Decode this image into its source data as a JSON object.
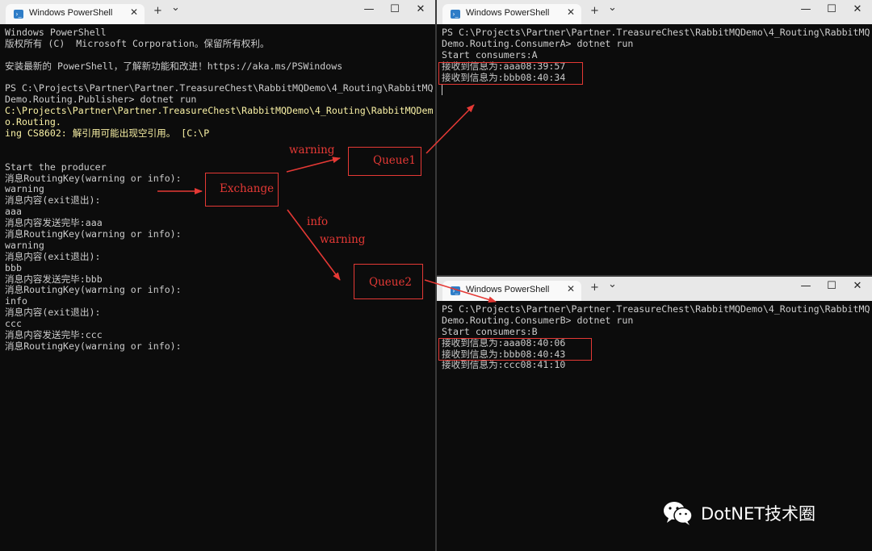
{
  "windows": {
    "publisher": {
      "title": "Windows PowerShell",
      "lines": [
        {
          "t": "Windows PowerShell",
          "c": "n"
        },
        {
          "t": "版权所有 (C)  Microsoft Corporation。保留所有权利。",
          "c": "n"
        },
        {
          "t": "",
          "c": "n"
        },
        {
          "t": "安装最新的 PowerShell，了解新功能和改进！https://aka.ms/PSWindows",
          "c": "n"
        },
        {
          "t": "",
          "c": "n"
        },
        {
          "t": "PS C:\\Projects\\Partner\\Partner.TreasureChest\\RabbitMQDemo\\4_Routing\\RabbitMQ",
          "c": "n"
        },
        {
          "t": "Demo.Routing.Publisher> dotnet run",
          "c": "n"
        },
        {
          "t": "C:\\Projects\\Partner\\Partner.TreasureChest\\RabbitMQDemo\\4_Routing\\RabbitMQDem",
          "c": "y"
        },
        {
          "t": "o.Routing.",
          "c": "y"
        },
        {
          "t": "ing CS8602: 解引用可能出现空引用。 [C:\\P",
          "c": "y"
        },
        {
          "t": "",
          "c": "n"
        },
        {
          "t": "",
          "c": "n"
        },
        {
          "t": "Start the producer",
          "c": "n"
        },
        {
          "t": "消息RoutingKey(warning or info):",
          "c": "n"
        },
        {
          "t": "warning",
          "c": "n"
        },
        {
          "t": "消息内容(exit退出):",
          "c": "n"
        },
        {
          "t": "aaa",
          "c": "n"
        },
        {
          "t": "消息内容发送完毕:aaa",
          "c": "n"
        },
        {
          "t": "消息RoutingKey(warning or info):",
          "c": "n"
        },
        {
          "t": "warning",
          "c": "n"
        },
        {
          "t": "消息内容(exit退出):",
          "c": "n"
        },
        {
          "t": "bbb",
          "c": "n"
        },
        {
          "t": "消息内容发送完毕:bbb",
          "c": "n"
        },
        {
          "t": "消息RoutingKey(warning or info):",
          "c": "n"
        },
        {
          "t": "info",
          "c": "n"
        },
        {
          "t": "消息内容(exit退出):",
          "c": "n"
        },
        {
          "t": "ccc",
          "c": "n"
        },
        {
          "t": "消息内容发送完毕:ccc",
          "c": "n"
        },
        {
          "t": "消息RoutingKey(warning or info):",
          "c": "n"
        }
      ]
    },
    "consumer_a": {
      "title": "Windows PowerShell",
      "lines": [
        {
          "t": "PS C:\\Projects\\Partner\\Partner.TreasureChest\\RabbitMQDemo\\4_Routing\\RabbitMQ",
          "c": "n"
        },
        {
          "t": "Demo.Routing.ConsumerA> dotnet run",
          "c": "n"
        },
        {
          "t": "Start consumers:A",
          "c": "n"
        },
        {
          "t": "接收到信息为:aaa08:39:57",
          "c": "n"
        },
        {
          "t": "接收到信息为:bbb08:40:34",
          "c": "n"
        }
      ]
    },
    "consumer_b": {
      "title": "Windows PowerShell",
      "lines": [
        {
          "t": "PS C:\\Projects\\Partner\\Partner.TreasureChest\\RabbitMQDemo\\4_Routing\\RabbitMQ",
          "c": "n"
        },
        {
          "t": "Demo.Routing.ConsumerB> dotnet run",
          "c": "n"
        },
        {
          "t": "Start consumers:B",
          "c": "n"
        },
        {
          "t": "接收到信息为:aaa08:40:06",
          "c": "n"
        },
        {
          "t": "接收到信息为:bbb08:40:43",
          "c": "n"
        },
        {
          "t": "接收到信息为:ccc08:41:10",
          "c": "n"
        }
      ]
    }
  },
  "controls": {
    "new_tab": "+",
    "dropdown": "⌄",
    "minimize": "—",
    "maximize": "☐",
    "close": "✕",
    "tab_close": "✕",
    "ps_glyph": "›_"
  },
  "annotations": {
    "exchange": "Exchange",
    "queue1": "Queue1",
    "queue2": "Queue2",
    "warning_1": "warning",
    "info": "info",
    "warning_2": "warning",
    "color": "#e53935"
  },
  "watermark": {
    "text": "DotNET技术圈"
  }
}
